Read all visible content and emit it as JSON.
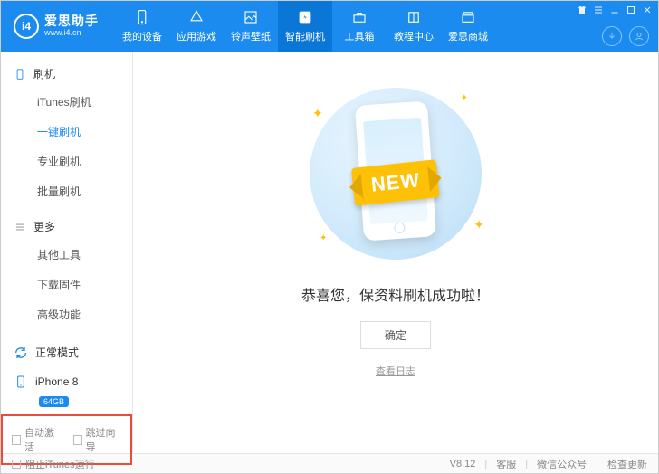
{
  "brand": {
    "name": "爱思助手",
    "sub": "www.i4.cn"
  },
  "nav": [
    {
      "label": "我的设备"
    },
    {
      "label": "应用游戏"
    },
    {
      "label": "铃声壁纸"
    },
    {
      "label": "智能刷机"
    },
    {
      "label": "工具箱"
    },
    {
      "label": "教程中心"
    },
    {
      "label": "爱思商城"
    }
  ],
  "sidebar": {
    "group1_title": "刷机",
    "group1_items": [
      "iTunes刷机",
      "一键刷机",
      "专业刷机",
      "批量刷机"
    ],
    "group2_title": "更多",
    "group2_items": [
      "其他工具",
      "下载固件",
      "高级功能"
    ],
    "mode": "正常模式",
    "device": "iPhone 8",
    "storage": "64GB",
    "chk1": "自动激活",
    "chk2": "跳过向导"
  },
  "main": {
    "ribbon": "NEW",
    "success": "恭喜您，保资料刷机成功啦！",
    "ok": "确定",
    "log": "查看日志"
  },
  "footer": {
    "block_itunes": "阻止iTunes运行",
    "version": "V8.12",
    "a": "客服",
    "b": "微信公众号",
    "c": "检查更新"
  }
}
